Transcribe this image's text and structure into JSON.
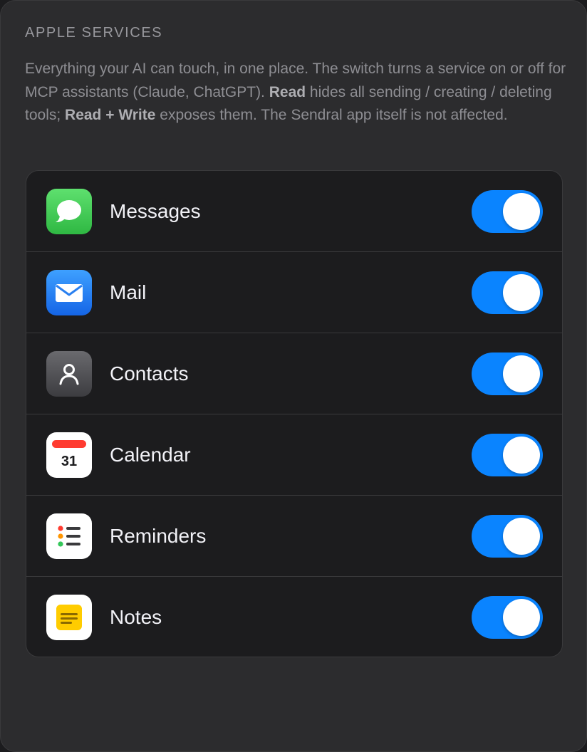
{
  "section": {
    "title": "APPLE SERVICES",
    "description": {
      "part1": "Everything your AI can touch, in one place. The switch turns a service on or off for MCP assistants (Claude, ChatGPT). ",
      "read_label": "Read",
      "part2": " hides all sending / creating / deleting tools; ",
      "read_write_label": "Read + Write",
      "part3": " exposes them. The Sendral app itself is not affected."
    }
  },
  "services": [
    {
      "label": "Messages",
      "icon": "messages-icon",
      "enabled": true
    },
    {
      "label": "Mail",
      "icon": "mail-icon",
      "enabled": true
    },
    {
      "label": "Contacts",
      "icon": "contacts-icon",
      "enabled": true
    },
    {
      "label": "Calendar",
      "icon": "calendar-icon",
      "enabled": true,
      "icon_text": "31"
    },
    {
      "label": "Reminders",
      "icon": "reminders-icon",
      "enabled": true
    },
    {
      "label": "Notes",
      "icon": "notes-icon",
      "enabled": true
    }
  ],
  "colors": {
    "toggle_on": "#0a84ff",
    "messages_green": "#34c759",
    "mail_blue": "#1e7cf5",
    "calendar_red": "#ff3b30",
    "notes_yellow": "#ffcc00"
  }
}
